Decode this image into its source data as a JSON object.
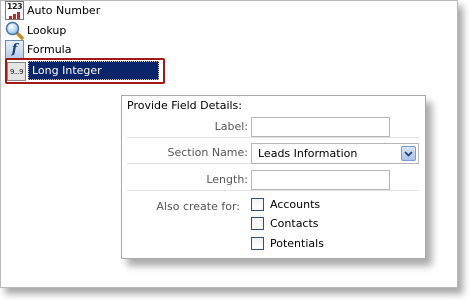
{
  "field_types": [
    {
      "label": "Auto Number",
      "icon": "auto-number-icon",
      "icon_text": "123"
    },
    {
      "label": "Lookup",
      "icon": "magnifier-icon"
    },
    {
      "label": "Formula",
      "icon": "formula-icon",
      "icon_text": "f"
    },
    {
      "label": "Long Integer",
      "icon": "long-integer-icon",
      "icon_text": "9...9",
      "selected": true
    }
  ],
  "details": {
    "title": "Provide Field Details:",
    "label_field": {
      "label": "Label:",
      "value": ""
    },
    "section_field": {
      "label": "Section Name:",
      "value": "Leads Information"
    },
    "length_field": {
      "label": "Length:",
      "value": ""
    },
    "also_create": {
      "label": "Also create for:",
      "options": [
        {
          "label": "Accounts",
          "checked": false
        },
        {
          "label": "Contacts",
          "checked": false
        },
        {
          "label": "Potentials",
          "checked": false
        }
      ]
    }
  },
  "colors": {
    "selection_bg": "#0a246a",
    "highlight_border": "#a11a1a",
    "label_text": "#555555"
  }
}
